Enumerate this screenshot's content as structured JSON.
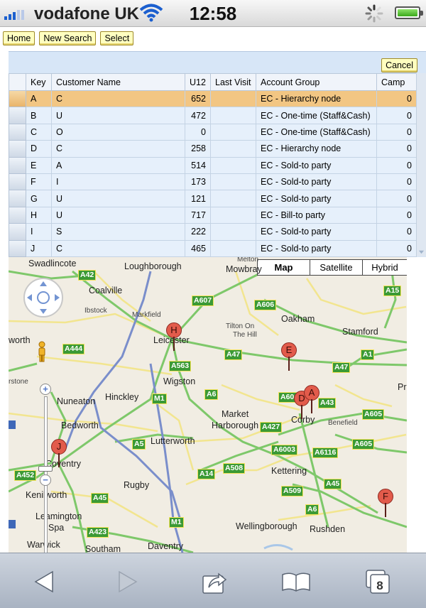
{
  "status": {
    "carrier": "vodafone UK",
    "time": "12:58"
  },
  "top_buttons": {
    "home": "Home",
    "new_search": "New Search",
    "select": "Select"
  },
  "panel": {
    "cancel": "Cancel"
  },
  "table": {
    "headers": [
      "",
      "Key",
      "Customer Name",
      "U12",
      "Last Visit",
      "Account Group",
      "Camp"
    ],
    "selected_row": 0,
    "rows": [
      {
        "key": "A",
        "name": "C",
        "u12": "652",
        "last_visit": "",
        "group": "EC - Hierarchy node",
        "camp": "0"
      },
      {
        "key": "B",
        "name": "U",
        "u12": "472",
        "last_visit": "",
        "group": "EC - One-time (Staff&Cash)",
        "camp": "0"
      },
      {
        "key": "C",
        "name": "O",
        "u12": "0",
        "last_visit": "",
        "group": "EC - One-time (Staff&Cash)",
        "camp": "0"
      },
      {
        "key": "D",
        "name": "C",
        "u12": "258",
        "last_visit": "",
        "group": "EC - Hierarchy node",
        "camp": "0"
      },
      {
        "key": "E",
        "name": "A",
        "u12": "514",
        "last_visit": "",
        "group": "EC - Sold-to party",
        "camp": "0"
      },
      {
        "key": "F",
        "name": "I",
        "u12": "173",
        "last_visit": "",
        "group": "EC - Sold-to party",
        "camp": "0"
      },
      {
        "key": "G",
        "name": "U",
        "u12": "121",
        "last_visit": "",
        "group": "EC - Sold-to party",
        "camp": "0"
      },
      {
        "key": "H",
        "name": "U",
        "u12": "717",
        "last_visit": "",
        "group": "EC - Bill-to party",
        "camp": "0"
      },
      {
        "key": "I",
        "name": "S",
        "u12": "222",
        "last_visit": "",
        "group": "EC - Sold-to party",
        "camp": "0"
      },
      {
        "key": "J",
        "name": "C",
        "u12": "465",
        "last_visit": "",
        "group": "EC - Sold-to party",
        "camp": "0"
      }
    ]
  },
  "map": {
    "type_buttons": [
      "Map",
      "Satellite",
      "Hybrid"
    ],
    "active_type": "Map",
    "places": [
      "Swadlincote",
      "Loughborough",
      "Melton",
      "Mowbray",
      "Coalville",
      "Ibstock",
      "Markfield",
      "Oakham",
      "Tilton On",
      "The Hill",
      "Stamford",
      "Leicester",
      "worth",
      "Wigston",
      "rstone",
      "Hinckley",
      "Nuneaton",
      "Market",
      "Harborough",
      "Corby",
      "Benefield",
      "Bedworth",
      "Lutterworth",
      "Coventry",
      "Kettering",
      "Rugby",
      "Kenilworth",
      "Leamington",
      "Spa",
      "Wellingborough",
      "Rushden",
      "Warwick",
      "Southam",
      "Daventry",
      "Pr"
    ],
    "roads": [
      "A42",
      "A607",
      "A606",
      "A15",
      "A444",
      "A563",
      "A47",
      "A1",
      "A6",
      "A47",
      "A606",
      "A43",
      "M1",
      "A605",
      "A5",
      "A427",
      "A6003",
      "A6116",
      "A605",
      "A452",
      "A14",
      "A508",
      "A509",
      "A45",
      "A6",
      "A423",
      "A45",
      "M1"
    ],
    "markers": [
      "H",
      "E",
      "D",
      "A",
      "J",
      "F"
    ]
  },
  "toolbar": {
    "tabs_count": "8",
    "icons": [
      "back-arrow-icon",
      "forward-arrow-icon",
      "share-icon",
      "bookmarks-icon",
      "tabs-icon"
    ]
  }
}
